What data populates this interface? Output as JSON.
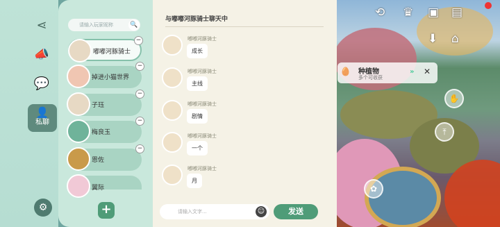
{
  "rail": {
    "items": [
      {
        "icon": "share-icon",
        "glyph": "⋖"
      },
      {
        "icon": "megaphone-icon",
        "glyph": "📣"
      },
      {
        "icon": "chat-bubble-icon",
        "glyph": "💬"
      }
    ],
    "active": {
      "icon": "private-chat-icon",
      "glyph": "👤",
      "label": "私聊"
    },
    "settings_glyph": "⚙"
  },
  "friends": {
    "search_placeholder": "请输入玩家昵称",
    "search_glyph": "🔍",
    "list": [
      {
        "name": "嘟嘟河豚骑士"
      },
      {
        "name": "掉进小猫世界"
      },
      {
        "name": "子珏"
      },
      {
        "name": "梅良玉"
      },
      {
        "name": "恩佐"
      },
      {
        "name": "翼际"
      }
    ],
    "remove_glyph": "−",
    "add_glyph": "+"
  },
  "chat": {
    "title": "与嘟嘟河豚骑士聊天中",
    "messages": [
      {
        "sender": "嘟嘟河豚骑士",
        "text": "成长"
      },
      {
        "sender": "嘟嘟河豚骑士",
        "text": "主线"
      },
      {
        "sender": "嘟嘟河豚骑士",
        "text": "剧情"
      },
      {
        "sender": "嘟嘟河豚骑士",
        "text": "一个"
      },
      {
        "sender": "嘟嘟河豚骑士",
        "text": "月"
      }
    ],
    "input_placeholder": "请输入文字...",
    "emoji_glyph": "☺",
    "send_label": "发送"
  },
  "hud": {
    "plant_title": "种植物",
    "plant_sub": "多个可收获",
    "plant_go": "»",
    "plant_close": "✕",
    "notify_badge": "!"
  },
  "colors": {
    "accent": "#4f9c78",
    "chat_bg": "#f5f2e6",
    "panel_bg": "#c9e8dc"
  }
}
